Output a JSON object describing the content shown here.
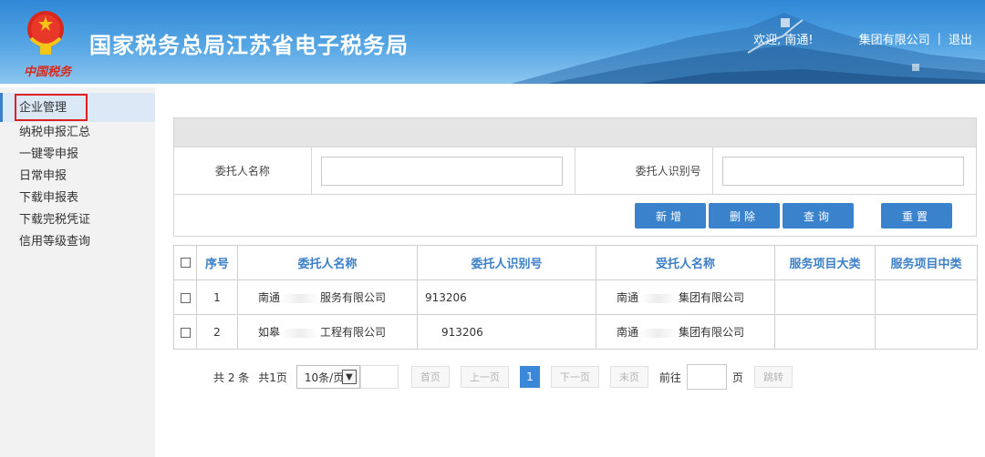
{
  "header": {
    "site_title": "国家税务总局江苏省电子税务局",
    "brand_mark": "中国税务",
    "welcome": "欢迎, 南通!",
    "company": "集团有限公司",
    "separator": "|",
    "logout": "退出"
  },
  "sidebar": {
    "items": [
      {
        "label": "企业管理",
        "active": true
      },
      {
        "label": "纳税申报汇总"
      },
      {
        "label": "一键零申报"
      },
      {
        "label": "日常申报"
      },
      {
        "label": "下载申报表"
      },
      {
        "label": "下载完税凭证"
      },
      {
        "label": "信用等级查询"
      }
    ]
  },
  "search": {
    "client_name_label": "委托人名称",
    "client_name_value": "",
    "client_id_label": "委托人识别号",
    "client_id_value": ""
  },
  "buttons": {
    "add": "新增",
    "delete": "删除",
    "query": "查询",
    "reset": "重置"
  },
  "table": {
    "headers": [
      "序号",
      "委托人名称",
      "委托人识别号",
      "受托人名称",
      "服务项目大类",
      "服务项目中类"
    ],
    "rows": [
      {
        "index": "1",
        "client_name_a": "南通",
        "client_name_b": "服务有限公司",
        "client_id": "913206",
        "agent_a": "南通",
        "agent_b": "集团有限公司",
        "major": "",
        "minor": ""
      },
      {
        "index": "2",
        "client_name_a": "如皋",
        "client_name_b": "工程有限公司",
        "client_id": "913206",
        "agent_a": "南通",
        "agent_b": "集团有限公司",
        "major": "",
        "minor": ""
      }
    ]
  },
  "pager": {
    "total": "共 2 条",
    "pages": "共1页",
    "page_size": "10条/页",
    "first": "首页",
    "prev": "上一页",
    "current": "1",
    "next": "下一页",
    "last": "末页",
    "goto_prefix": "前往",
    "goto_suffix": "页",
    "jump": "跳转"
  },
  "colors": {
    "accent": "#3b82cc",
    "header_text": "#3b7fc6",
    "highlight_border": "#e02020"
  }
}
